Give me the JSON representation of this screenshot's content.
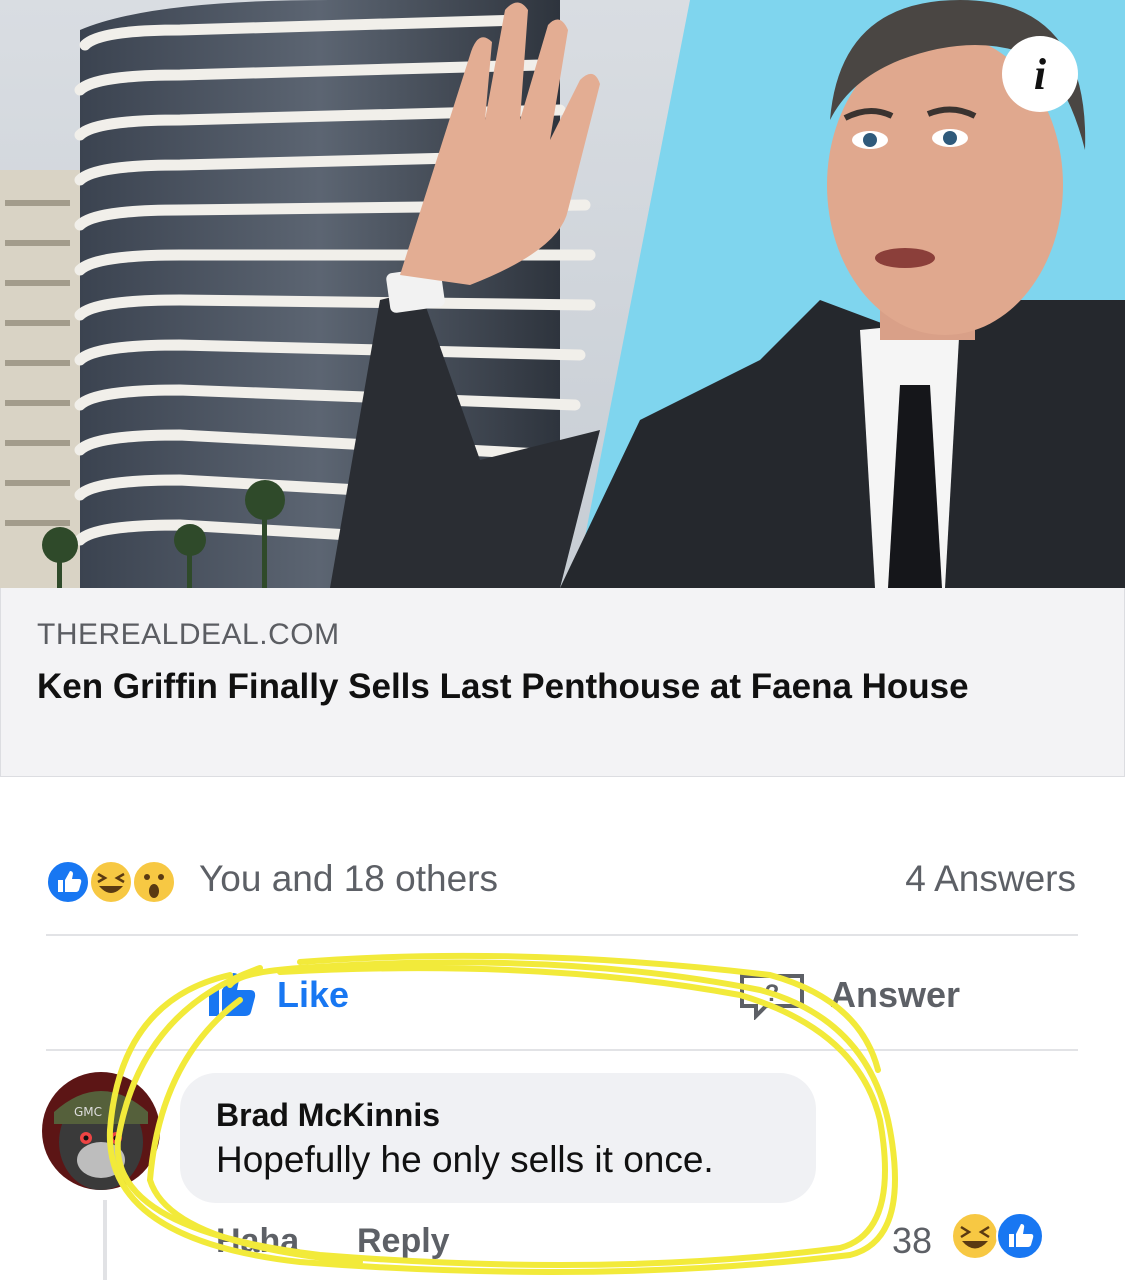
{
  "link_preview": {
    "domain": "THEREALDEAL.COM",
    "headline": "Ken Griffin Finally Sells Last Penthouse at Faena House",
    "info_icon": "i"
  },
  "reactions": {
    "icons": [
      "like-icon",
      "haha-icon",
      "wow-icon"
    ],
    "summary": "You and 18 others",
    "answers_count": "4 Answers"
  },
  "actions": {
    "like_label": "Like",
    "answer_label": "Answer"
  },
  "comment": {
    "author": "Brad McKinnis",
    "text": "Hopefully he only sells it once.",
    "haha_label": "Haha",
    "reply_label": "Reply",
    "reaction_count": "38",
    "reaction_icons": [
      "haha-icon",
      "like-icon"
    ]
  },
  "colors": {
    "facebook_blue": "#1877f2",
    "haha_yellow": "#f7c843",
    "highlight_yellow": "#f2ea3a"
  }
}
